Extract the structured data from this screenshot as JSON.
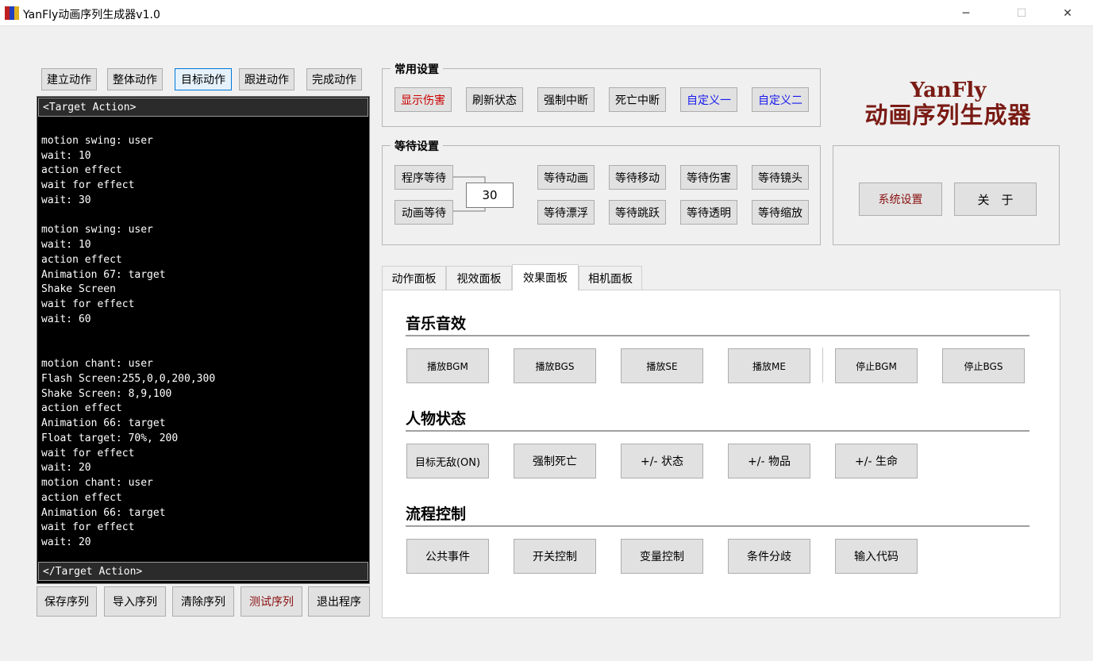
{
  "window": {
    "title": "YanFly动画序列生成器v1.0",
    "min_glyph": "─",
    "max_glyph": "☐",
    "close_glyph": "✕"
  },
  "action_tabs": [
    "建立动作",
    "整体动作",
    "目标动作",
    "跟进动作",
    "完成动作"
  ],
  "editor": {
    "header": "<Target Action>",
    "footer": "</Target Action>",
    "code": "\nmotion swing: user\nwait: 10\naction effect\nwait for effect\nwait: 30\n\nmotion swing: user\nwait: 10\naction effect\nAnimation 67: target\nShake Screen\nwait for effect\nwait: 60\n\n\nmotion chant: user\nFlash Screen:255,0,0,200,300\nShake Screen: 8,9,100\naction effect\nAnimation 66: target\nFloat target: 70%, 200\nwait for effect\nwait: 20\nmotion chant: user\naction effect\nAnimation 66: target\nwait for effect\nwait: 20"
  },
  "bottom_buttons": [
    "保存序列",
    "导入序列",
    "清除序列",
    "测试序列",
    "退出程序"
  ],
  "common_settings": {
    "title": "常用设置",
    "buttons": [
      "显示伤害",
      "刷新状态",
      "强制中断",
      "死亡中断",
      "自定义一",
      "自定义二"
    ]
  },
  "wait_settings": {
    "title": "等待设置",
    "program_wait": "程序等待",
    "animation_wait": "动画等待",
    "wait_value": "30",
    "buttons": [
      "等待动画",
      "等待移动",
      "等待伤害",
      "等待镜头",
      "等待漂浮",
      "等待跳跃",
      "等待透明",
      "等待缩放"
    ]
  },
  "logo": {
    "en": "YanFly",
    "cn": "动画序列生成器"
  },
  "system": {
    "settings": "系统设置",
    "about": "关　于"
  },
  "tabs": [
    "动作面板",
    "视效面板",
    "效果面板",
    "相机面板"
  ],
  "sections": [
    {
      "title": "音乐音效",
      "buttons": [
        "播放BGM",
        "播放BGS",
        "播放SE",
        "播放ME",
        "停止BGM",
        "停止BGS"
      ]
    },
    {
      "title": "人物状态",
      "buttons": [
        "目标无敌(ON)",
        "强制死亡",
        "+/- 状态",
        "+/- 物品",
        "+/- 生命"
      ]
    },
    {
      "title": "流程控制",
      "buttons": [
        "公共事件",
        "开关控制",
        "变量控制",
        "条件分歧",
        "输入代码"
      ]
    }
  ],
  "colors": {
    "logo": "#7a1a14",
    "red_text": "#cc0000",
    "blue_text": "#1a1aee",
    "test_text": "#8b1010",
    "editor_bg": "#000000"
  }
}
